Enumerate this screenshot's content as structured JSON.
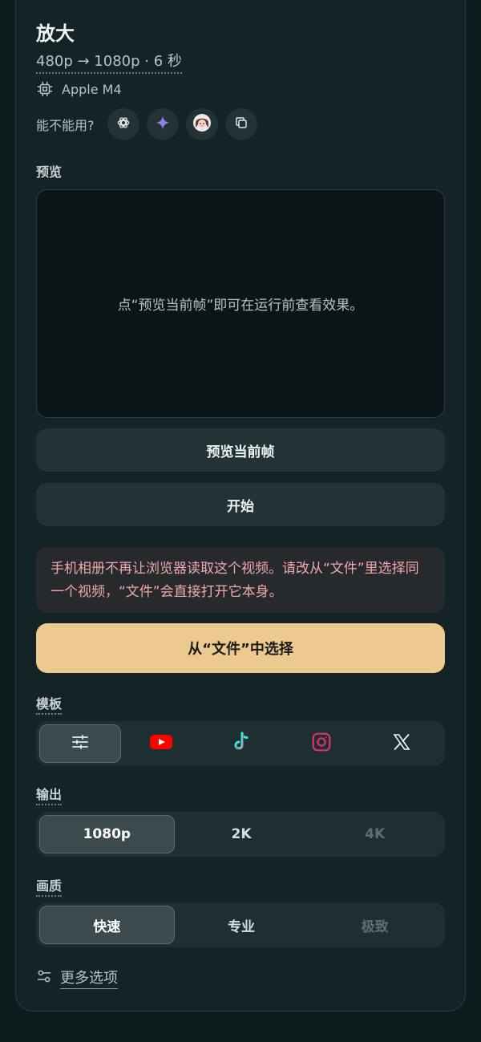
{
  "header": {
    "title": "放大",
    "subtitle": "480p → 1080p · 6 秒",
    "chip_label": "Apple M4",
    "ask_label": "能不能用?"
  },
  "ask_buttons": [
    {
      "icon": "openai-icon"
    },
    {
      "icon": "sparkle-icon"
    },
    {
      "icon": "avatar-icon"
    },
    {
      "icon": "copy-icon"
    }
  ],
  "preview": {
    "label": "预览",
    "hint": "点“预览当前帧”即可在运行前查看效果。"
  },
  "actions": {
    "preview_frame": "预览当前帧",
    "start": "开始"
  },
  "warning": {
    "text": "手机相册不再让浏览器读取这个视频。请改从“文件”里选择同一个视频，“文件”会直接打开它本身。"
  },
  "choose_file": "从“文件”中选择",
  "template": {
    "label": "模板",
    "options": [
      "custom",
      "youtube",
      "tiktok",
      "instagram",
      "x"
    ],
    "selected": "custom"
  },
  "output": {
    "label": "输出",
    "options": [
      "1080p",
      "2K",
      "4K"
    ],
    "selected": "1080p",
    "disabled": [
      "4K"
    ]
  },
  "quality": {
    "label": "画质",
    "options": [
      "快速",
      "专业",
      "极致"
    ],
    "selected": "快速",
    "disabled": [
      "极致"
    ]
  },
  "more_options": "更多选项",
  "colors": {
    "accent": "#ecc98e",
    "warning_text": "#f0a9a8",
    "youtube": "#ff0000",
    "tiktok_cyan": "#25f4ee",
    "instagram": "#e1306c"
  }
}
